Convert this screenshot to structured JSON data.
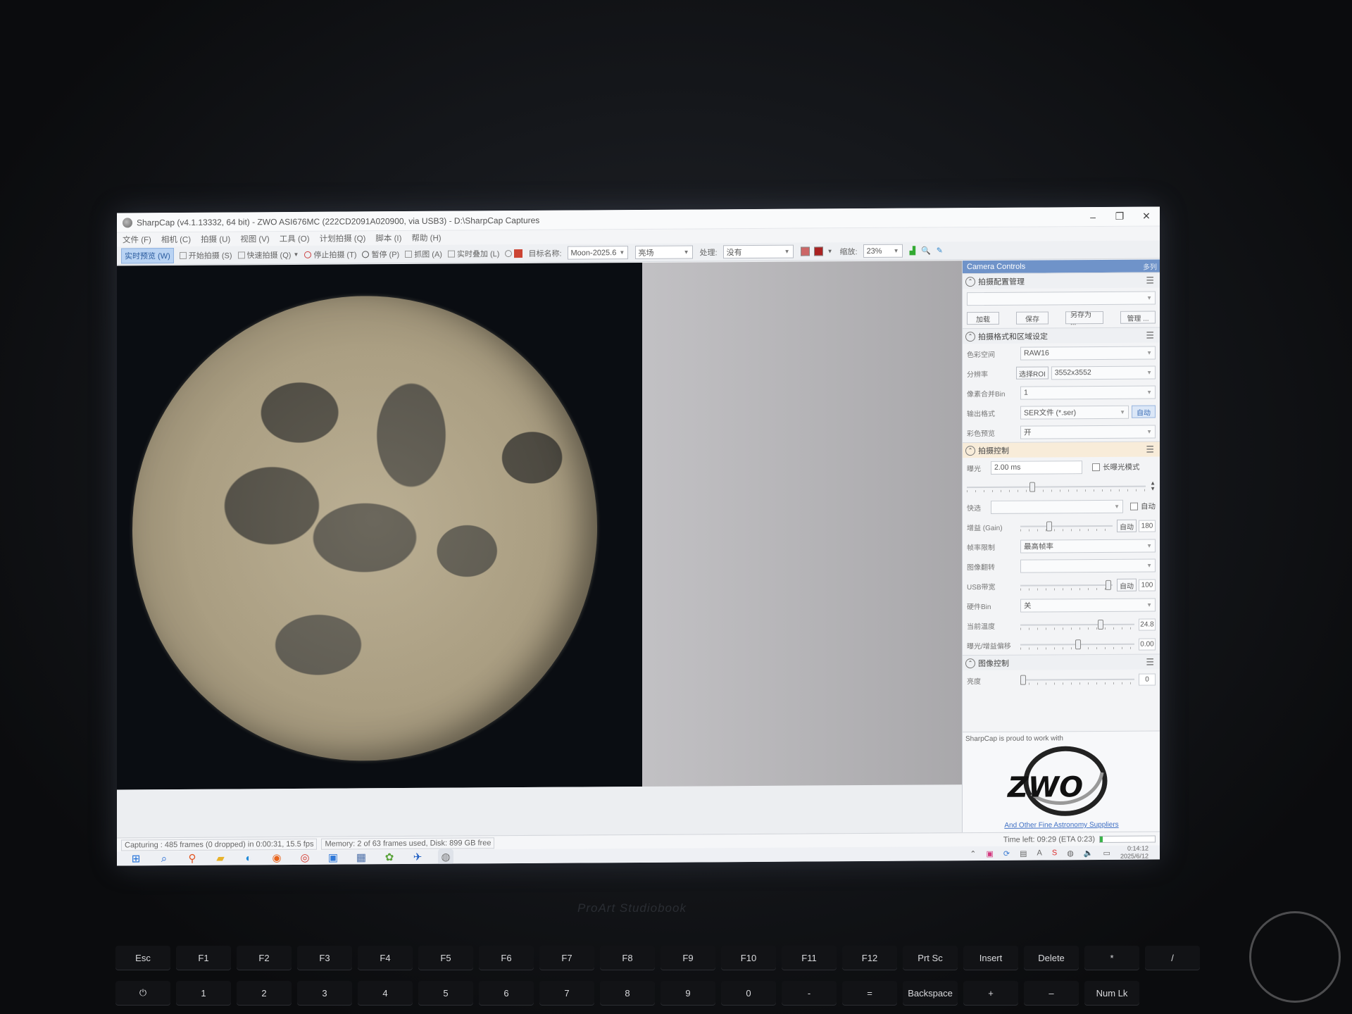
{
  "window": {
    "title": "SharpCap (v4.1.13332, 64 bit) - ZWO ASI676MC (222CD2091A020900, via USB3) - D:\\SharpCap Captures",
    "minimize": "–",
    "restore": "❐",
    "close": "✕"
  },
  "menu": [
    "文件 (F)",
    "相机 (C)",
    "拍摄 (U)",
    "视图 (V)",
    "工具 (O)",
    "计划拍摄 (Q)",
    "脚本 (I)",
    "帮助 (H)"
  ],
  "toolbar": {
    "live_preview": "实时预览 (W)",
    "start_capture": "开始拍摄 (S)",
    "quick_capture": "快速拍摄 (Q)",
    "stop_capture": "停止拍摄 (T)",
    "pause": "暂停 (P)",
    "snapshot": "抓图 (A)",
    "live_stack": "实时叠加 (L)",
    "target_label": "目标名称:",
    "target_value": "Moon-2025.6",
    "field_value": "亮场",
    "process_label": "处理:",
    "process_value": "没有",
    "zoom_label": "缩放:",
    "zoom_value": "23%"
  },
  "panel": {
    "header": "Camera Controls",
    "header_right": "多列",
    "profile": {
      "title": "拍摄配置管理",
      "load": "加载",
      "save": "保存",
      "save_as": "另存为 ...",
      "manage": "管理 ..."
    },
    "format": {
      "title": "拍摄格式和区域设定",
      "color_space_label": "色彩空间",
      "color_space": "RAW16",
      "resolution_label": "分辨率",
      "select_roi": "选择ROI",
      "resolution": "3552x3552",
      "binning_label": "像素合并Bin",
      "binning": "1",
      "output_label": "输出格式",
      "output": "SER文件 (*.ser)",
      "auto": "自动",
      "color_preview_label": "彩色预览",
      "color_preview": "开"
    },
    "capture": {
      "title": "拍摄控制",
      "exposure_label": "曝光",
      "exposure": "2.00 ms",
      "long_exposure": "长曝光模式",
      "quick_label": "快选",
      "auto": "自动",
      "gain_label": "增益 (Gain)",
      "gain_value": "180",
      "frame_limit_label": "帧率限制",
      "frame_limit": "最高帧率",
      "flip_label": "图像翻转",
      "usb_label": "USB带宽",
      "usb_value": "100",
      "hw_bin_label": "硬件Bin",
      "hw_bin": "关",
      "temp_label": "当前温度",
      "temp_value": "24.8",
      "offset_label": "曝光/增益偏移",
      "offset_value": "0.00"
    },
    "image": {
      "title": "图像控制",
      "brightness_label": "亮度",
      "brightness_value": "0"
    },
    "sponsor": {
      "caption": "SharpCap is proud to work with",
      "logo_text": "ZWO",
      "link": "And Other Fine Astronomy Suppliers"
    }
  },
  "status": {
    "capturing": "Capturing : 485 frames (0 dropped) in 0:00:31, 15.5 fps",
    "memory": "Memory: 2 of 63 frames used, Disk: 899 GB free",
    "time_left": "Time left: 09:29 (ETA 0:23)",
    "progress": 0.05
  },
  "taskbar": {
    "time": "0:14:12",
    "date": "2025/6/12"
  },
  "laptop": {
    "brand": "ProArt Studiobook",
    "keys": [
      "Esc",
      "F1",
      "F2",
      "F3",
      "F4",
      "F5",
      "F6",
      "F7",
      "F8",
      "F9",
      "F10",
      "F11",
      "F12",
      "Prt Sc",
      "Insert",
      "Delete",
      "*",
      "/",
      "⏻"
    ],
    "keys2": [
      "1",
      "2",
      "3",
      "4",
      "5",
      "6",
      "7",
      "8",
      "9",
      "0",
      "-",
      "=",
      "Backspace",
      "+",
      "–",
      "Num Lk"
    ]
  },
  "colors": {
    "accent": "#6f93c9",
    "progress": "#3bb34a",
    "link": "#3e6fc4"
  }
}
